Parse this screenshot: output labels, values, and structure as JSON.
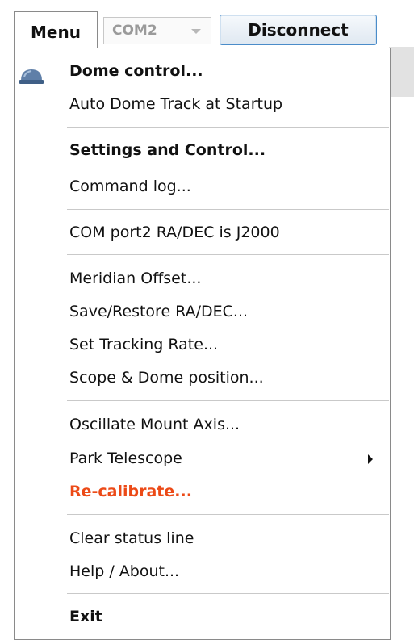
{
  "toolbar": {
    "menu_label": "Menu",
    "com_port_value": "COM2",
    "disconnect_label": "Disconnect"
  },
  "menu": {
    "dome_control": "Dome control...",
    "auto_dome_track": "Auto Dome Track at Startup",
    "settings_and_control": "Settings and Control...",
    "command_log": "Command log...",
    "com_port_radec": "COM port2 RA/DEC is J2000",
    "meridian_offset": "Meridian Offset...",
    "save_restore_radec": "Save/Restore RA/DEC...",
    "set_tracking_rate": "Set Tracking Rate...",
    "scope_dome_position": "Scope & Dome position...",
    "oscillate_mount_axis": "Oscillate Mount Axis...",
    "park_telescope": "Park Telescope",
    "recalibrate": "Re-calibrate...",
    "clear_status_line": "Clear status line",
    "help_about": "Help / About...",
    "exit": "Exit"
  },
  "colors": {
    "recalibrate_text": "#ec4a17",
    "disconnect_border": "#4a8cc9",
    "dome_icon": "#5f7fa8"
  },
  "icons": {
    "dome_control": "dome-icon",
    "park_telescope": "submenu-arrow-icon",
    "com_port": "chevron-down-icon"
  }
}
